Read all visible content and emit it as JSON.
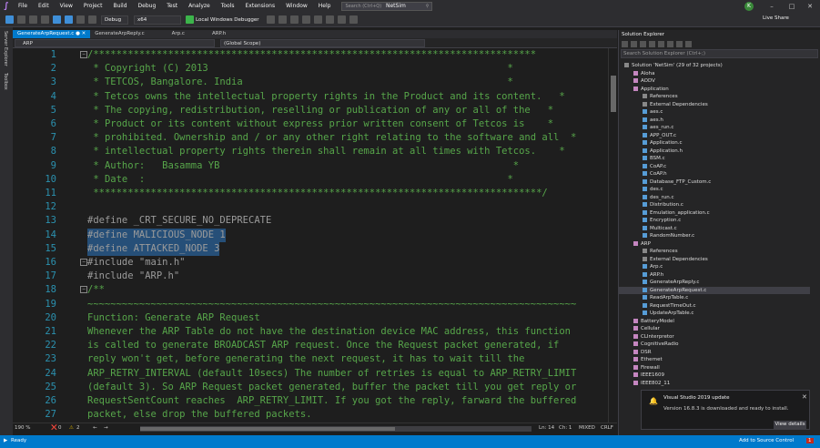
{
  "menu": [
    "File",
    "Edit",
    "View",
    "Project",
    "Build",
    "Debug",
    "Test",
    "Analyze",
    "Tools",
    "Extensions",
    "Window",
    "Help"
  ],
  "search_placeholder": "Search (Ctrl+Q)",
  "solution_title": "NetSim",
  "user_initial": "K",
  "toolbar": {
    "config": "Debug",
    "platform": "x64",
    "run_label": "Local Windows Debugger",
    "live_share": "Live Share"
  },
  "left_strip": [
    "Server Explorer",
    "Toolbox"
  ],
  "tabs": [
    "GenerateArpRequest.c",
    "GenerateArpReply.c",
    "Arp.c",
    "ARP.h"
  ],
  "nav": {
    "project": "ARP",
    "scope": "(Global Scope)"
  },
  "code_lines": [
    {
      "n": "1",
      "t": "/*****************************************************************************",
      "c": "c-comment",
      "fold": "−"
    },
    {
      "n": "2",
      "t": " * Copyright (C) 2013                                                    *",
      "c": "c-comment"
    },
    {
      "n": "3",
      "t": " * TETCOS, Bangalore. India                                              *",
      "c": "c-comment"
    },
    {
      "n": "4",
      "t": " * Tetcos owns the intellectual property rights in the Product and its content.   *",
      "c": "c-comment"
    },
    {
      "n": "5",
      "t": " * The copying, redistribution, reselling or publication of any or all of the   *",
      "c": "c-comment"
    },
    {
      "n": "6",
      "t": " * Product or its content without express prior written consent of Tetcos is    *",
      "c": "c-comment"
    },
    {
      "n": "7",
      "t": " * prohibited. Ownership and / or any other right relating to the software and all  *",
      "c": "c-comment"
    },
    {
      "n": "8",
      "t": " * intellectual property rights therein shall remain at all times with Tetcos.    *",
      "c": "c-comment"
    },
    {
      "n": "9",
      "t": " * Author:   Basamma YB                                                   *",
      "c": "c-comment"
    },
    {
      "n": "10",
      "t": " * Date  :                                                               *",
      "c": "c-comment"
    },
    {
      "n": "11",
      "t": " ******************************************************************************/",
      "c": "c-comment"
    },
    {
      "n": "12",
      "t": "",
      "c": ""
    },
    {
      "n": "13",
      "t": "#define _CRT_SECURE_NO_DEPRECATE",
      "c": "c-macro"
    },
    {
      "n": "14",
      "t": "#define MALICIOUS_NODE 1",
      "c": "c-macro hl"
    },
    {
      "n": "15",
      "t": "#define ATTACKED_NODE 3",
      "c": "c-macro hl"
    },
    {
      "n": "16",
      "t": "#include \"main.h\"",
      "c": "c-macro",
      "fold": "−"
    },
    {
      "n": "17",
      "t": "#include \"ARP.h\"",
      "c": "c-macro"
    },
    {
      "n": "18",
      "t": "/**",
      "c": "c-comment",
      "fold": "−"
    },
    {
      "n": "19",
      "t": "~~~~~~~~~~~~~~~~~~~~~~~~~~~~~~~~~~~~~~~~~~~~~~~~~~~~~~~~~~~~~~~~~~~~~~~~~~~~~~~~~~~~~",
      "c": "c-comment"
    },
    {
      "n": "20",
      "t": "Function: Generate ARP Request",
      "c": "c-comment"
    },
    {
      "n": "21",
      "t": "Whenever the ARP Table do not have the destination device MAC address, this function",
      "c": "c-comment"
    },
    {
      "n": "22",
      "t": "is called to generate BROADCAST ARP request. Once the Request packet generated, if",
      "c": "c-comment"
    },
    {
      "n": "23",
      "t": "reply won't get, before generating the next request, it has to wait till the",
      "c": "c-comment"
    },
    {
      "n": "24",
      "t": "ARP_RETRY_INTERVAL (default 10secs) The number of retries is equal to ARP_RETRY_LIMIT",
      "c": "c-comment"
    },
    {
      "n": "25",
      "t": "(default 3). So ARP Request packet generated, buffer the packet till you get reply or",
      "c": "c-comment"
    },
    {
      "n": "26",
      "t": "RequestSentCount reaches  ARP_RETRY_LIMIT. If you got the reply, farward the buffered",
      "c": "c-comment"
    },
    {
      "n": "27",
      "t": "packet, else drop the buffered packets.",
      "c": "c-comment"
    }
  ],
  "editor_status": {
    "zoom": "190 %",
    "errors": "0",
    "warnings": "2",
    "ln": "Ln: 14",
    "ch": "Ch: 1",
    "mixed": "MIXED",
    "crlf": "CRLF"
  },
  "solution_explorer": {
    "title": "Solution Explorer",
    "search": "Search Solution Explorer (Ctrl+;)",
    "items": [
      {
        "label": "Solution 'NetSim' (29 of 32 projects)",
        "d": 0,
        "ic": "#888"
      },
      {
        "label": "Aloha",
        "d": 1,
        "ic": "#c586c0"
      },
      {
        "label": "AODV",
        "d": 1,
        "ic": "#c586c0"
      },
      {
        "label": "Application",
        "d": 1,
        "ic": "#c586c0"
      },
      {
        "label": "References",
        "d": 2,
        "ic": "#888"
      },
      {
        "label": "External Dependencies",
        "d": 2,
        "ic": "#888"
      },
      {
        "label": "aes.c",
        "d": 2,
        "ic": "#569cd6"
      },
      {
        "label": "aes.h",
        "d": 2,
        "ic": "#569cd6"
      },
      {
        "label": "aes_run.c",
        "d": 2,
        "ic": "#569cd6"
      },
      {
        "label": "APP_OUT.c",
        "d": 2,
        "ic": "#569cd6"
      },
      {
        "label": "Application.c",
        "d": 2,
        "ic": "#569cd6"
      },
      {
        "label": "Application.h",
        "d": 2,
        "ic": "#569cd6"
      },
      {
        "label": "BSM.c",
        "d": 2,
        "ic": "#569cd6"
      },
      {
        "label": "CoAP.c",
        "d": 2,
        "ic": "#569cd6"
      },
      {
        "label": "CoAP.h",
        "d": 2,
        "ic": "#569cd6"
      },
      {
        "label": "Database_FTP_Custom.c",
        "d": 2,
        "ic": "#569cd6"
      },
      {
        "label": "des.c",
        "d": 2,
        "ic": "#569cd6"
      },
      {
        "label": "des_run.c",
        "d": 2,
        "ic": "#569cd6"
      },
      {
        "label": "Distribution.c",
        "d": 2,
        "ic": "#569cd6"
      },
      {
        "label": "Emulation_application.c",
        "d": 2,
        "ic": "#569cd6"
      },
      {
        "label": "Encryption.c",
        "d": 2,
        "ic": "#569cd6"
      },
      {
        "label": "Multicast.c",
        "d": 2,
        "ic": "#569cd6"
      },
      {
        "label": "RandomNumber.c",
        "d": 2,
        "ic": "#569cd6"
      },
      {
        "label": "ARP",
        "d": 1,
        "ic": "#c586c0"
      },
      {
        "label": "References",
        "d": 2,
        "ic": "#888"
      },
      {
        "label": "External Dependencies",
        "d": 2,
        "ic": "#888"
      },
      {
        "label": "Arp.c",
        "d": 2,
        "ic": "#569cd6"
      },
      {
        "label": "ARP.h",
        "d": 2,
        "ic": "#569cd6"
      },
      {
        "label": "GenerateArpReply.c",
        "d": 2,
        "ic": "#569cd6"
      },
      {
        "label": "GenerateArpRequest.c",
        "d": 2,
        "ic": "#569cd6",
        "sel": true
      },
      {
        "label": "ReadArpTable.c",
        "d": 2,
        "ic": "#569cd6"
      },
      {
        "label": "RequestTimeOut.c",
        "d": 2,
        "ic": "#569cd6"
      },
      {
        "label": "UpdateArpTable.c",
        "d": 2,
        "ic": "#569cd6"
      },
      {
        "label": "BatteryModel",
        "d": 1,
        "ic": "#c586c0"
      },
      {
        "label": "Cellular",
        "d": 1,
        "ic": "#c586c0"
      },
      {
        "label": "CLInterpretor",
        "d": 1,
        "ic": "#c586c0"
      },
      {
        "label": "CognitiveRadio",
        "d": 1,
        "ic": "#c586c0"
      },
      {
        "label": "DSR",
        "d": 1,
        "ic": "#c586c0"
      },
      {
        "label": "Ethernet",
        "d": 1,
        "ic": "#c586c0"
      },
      {
        "label": "Firewall",
        "d": 1,
        "ic": "#c586c0"
      },
      {
        "label": "IEEE1609",
        "d": 1,
        "ic": "#c586c0"
      },
      {
        "label": "IEEE802_11",
        "d": 1,
        "ic": "#c586c0"
      }
    ]
  },
  "notification": {
    "title": "Visual Studio 2019 update",
    "message": "Version 16.8.3 is downloaded and ready to install.",
    "button": "View details"
  },
  "statusbar": {
    "ready": "Ready",
    "source_control": "Add to Source Control",
    "badge": "1"
  }
}
